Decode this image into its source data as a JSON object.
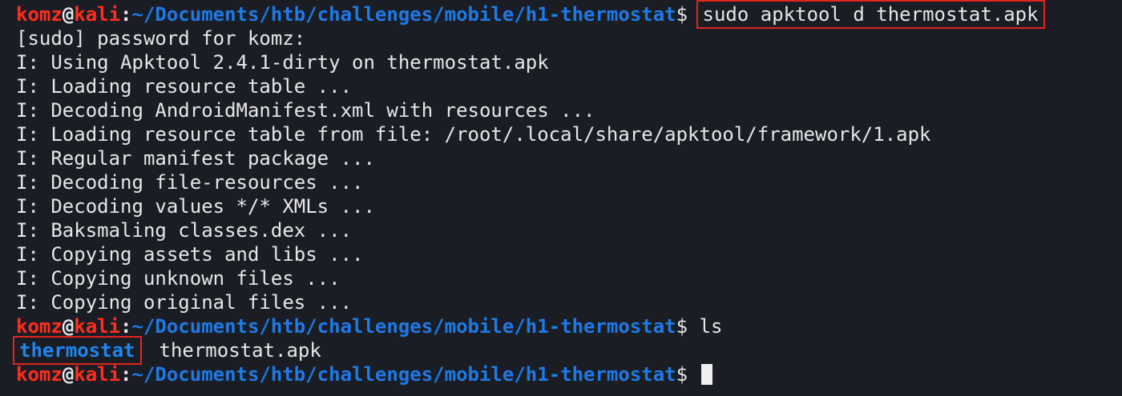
{
  "prompt": {
    "user": "komz",
    "at": "@",
    "host": "kali",
    "colon": ":",
    "path": "~/Documents/htb/challenges/mobile/h1-thermostat",
    "dollar": "$"
  },
  "commands": {
    "first": "sudo apktool d thermostat.apk",
    "second": "ls"
  },
  "output_lines": [
    "[sudo] password for komz:",
    "I: Using Apktool 2.4.1-dirty on thermostat.apk",
    "I: Loading resource table ...",
    "I: Decoding AndroidManifest.xml with resources ...",
    "I: Loading resource table from file: /root/.local/share/apktool/framework/1.apk",
    "I: Regular manifest package ...",
    "I: Decoding file-resources ...",
    "I: Decoding values */* XMLs ...",
    "I: Baksmaling classes.dex ...",
    "I: Copying assets and libs ...",
    "I: Copying unknown files ...",
    "I: Copying original files ..."
  ],
  "ls_output": {
    "directory": "thermostat",
    "file": "thermostat.apk"
  },
  "colors": {
    "background": "#1b1d24",
    "user_host": "#ff2e1f",
    "path": "#1e7ae6",
    "highlight_box": "#e0261e"
  },
  "icons": {
    "cursor": "block-cursor-icon"
  }
}
